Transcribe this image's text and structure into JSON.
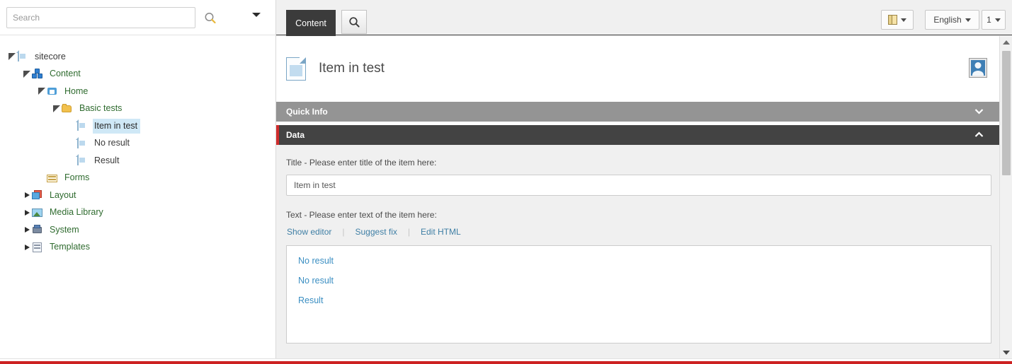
{
  "search": {
    "placeholder": "Search",
    "icon": "search-icon",
    "dropdown_icon": "caret-down-icon"
  },
  "tree": {
    "items": [
      {
        "label": "sitecore",
        "icon": "document-icon",
        "depth": 0,
        "toggle": "open",
        "selected": false,
        "green": false
      },
      {
        "label": "Content",
        "icon": "content-cubes-icon",
        "depth": 1,
        "toggle": "open",
        "selected": false,
        "green": true
      },
      {
        "label": "Home",
        "icon": "home-icon",
        "depth": 2,
        "toggle": "open",
        "selected": false,
        "green": true
      },
      {
        "label": "Basic tests",
        "icon": "folder-icon",
        "depth": 3,
        "toggle": "open",
        "selected": false,
        "green": true
      },
      {
        "label": "Item in test",
        "icon": "document-icon",
        "depth": 4,
        "toggle": "none",
        "selected": true,
        "green": false
      },
      {
        "label": "No result",
        "icon": "document-icon",
        "depth": 4,
        "toggle": "none",
        "selected": false,
        "green": false
      },
      {
        "label": "Result",
        "icon": "document-icon",
        "depth": 4,
        "toggle": "none",
        "selected": false,
        "green": false
      },
      {
        "label": "Forms",
        "icon": "forms-icon",
        "depth": 2,
        "toggle": "none",
        "selected": false,
        "green": true
      },
      {
        "label": "Layout",
        "icon": "layout-icon",
        "depth": 1,
        "toggle": "closed",
        "selected": false,
        "green": true
      },
      {
        "label": "Media Library",
        "icon": "media-icon",
        "depth": 1,
        "toggle": "closed",
        "selected": false,
        "green": true
      },
      {
        "label": "System",
        "icon": "system-icon",
        "depth": 1,
        "toggle": "closed",
        "selected": false,
        "green": true
      },
      {
        "label": "Templates",
        "icon": "templates-icon",
        "depth": 1,
        "toggle": "closed",
        "selected": false,
        "green": true
      }
    ]
  },
  "toolbar": {
    "tab_content": "Content",
    "tab_search_icon": "search-icon",
    "book_button_icon": "book-icon",
    "language_button": "English",
    "version_button": "1"
  },
  "item": {
    "title": "Item in test",
    "icon": "document-icon",
    "user_icon": "user-avatar-icon"
  },
  "sections": {
    "quick_info": {
      "label": "Quick Info",
      "chevron": "⌄",
      "state": "collapsed"
    },
    "data": {
      "label": "Data",
      "chevron": "⌃",
      "state": "expanded"
    }
  },
  "fields": {
    "title": {
      "label": "Title - Please enter title of the item here:",
      "value": "Item in test",
      "placeholder": ""
    },
    "text": {
      "label": "Text - Please enter text of the item here:",
      "links": [
        {
          "label": "Show editor"
        },
        {
          "label": "Suggest fix"
        },
        {
          "label": "Edit HTML"
        }
      ],
      "separator": "|",
      "content_links": [
        {
          "label": "No result"
        },
        {
          "label": "No result"
        },
        {
          "label": "Result"
        }
      ]
    }
  },
  "scrollbar": {
    "up_icon": "scroll-up-arrow-icon",
    "down_icon": "scroll-down-arrow-icon"
  },
  "colors": {
    "accent_red": "#cc2121",
    "section_active": "#434343",
    "section_inactive": "#949494",
    "tab_active": "#3b3b3b",
    "link_blue": "#3a8ec2",
    "tree_green": "#2f6b2f",
    "selection_blue": "#cfe8f6"
  }
}
